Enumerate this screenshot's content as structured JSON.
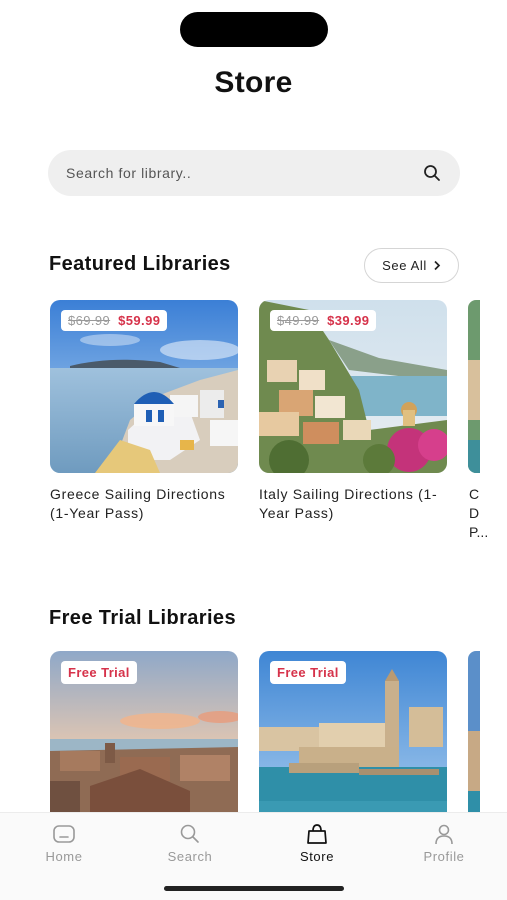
{
  "header": {
    "title": "Store"
  },
  "search": {
    "placeholder": "Search for library.."
  },
  "featured": {
    "title": "Featured Libraries",
    "see_all_label": "See All",
    "cards": [
      {
        "name": "Greece Sailing Directions (1-Year Pass)",
        "price_old": "$69.99",
        "price_new": "$59.99"
      },
      {
        "name": "Italy Sailing Directions (1-Year Pass)",
        "price_old": "$49.99",
        "price_new": "$39.99"
      }
    ],
    "peek_text": [
      "C",
      "D",
      "P..."
    ]
  },
  "free_trial": {
    "title": "Free Trial Libraries",
    "cards": [
      {
        "badge": "Free Trial"
      },
      {
        "badge": "Free Trial"
      }
    ]
  },
  "tabbar": {
    "items": [
      {
        "label": "Home",
        "icon": "home-icon",
        "active": false
      },
      {
        "label": "Search",
        "icon": "search-icon",
        "active": false
      },
      {
        "label": "Store",
        "icon": "bag-icon",
        "active": true
      },
      {
        "label": "Profile",
        "icon": "person-icon",
        "active": false
      }
    ]
  },
  "colors": {
    "accent": "#d6324a",
    "active_tab": "#111111",
    "inactive_tab": "#999999"
  }
}
